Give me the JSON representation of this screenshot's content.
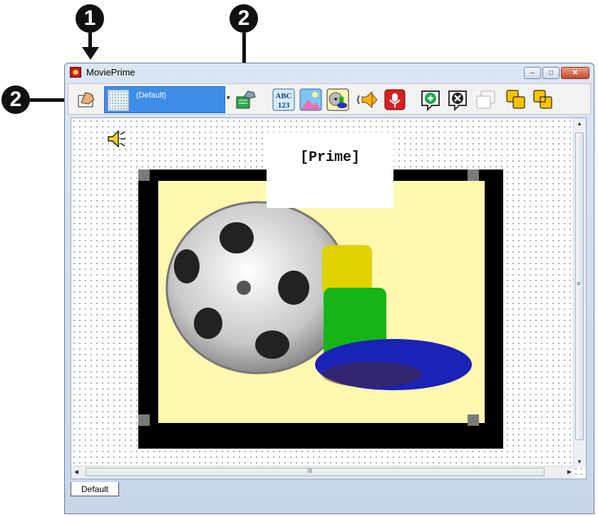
{
  "callouts": {
    "one": "1",
    "two_top": "2",
    "two_left": "2"
  },
  "window": {
    "title": "MoviePrime",
    "caption": {
      "minimize": "–",
      "maximize": "□",
      "close": "✕"
    }
  },
  "toolbar": {
    "layout_combo": {
      "value": "(Default)",
      "arrow": "▾"
    },
    "icons": [
      "edit-hand-icon",
      "layout-thumbnail-icon",
      "new-layout-icon",
      "text-abc123-icon",
      "image-icon",
      "movie-icon",
      "sound-speaker-icon",
      "record-mic-icon",
      "add-button-icon",
      "delete-button-icon",
      "duplicate-icon",
      "bring-forward-icon",
      "send-backward-icon"
    ]
  },
  "canvas": {
    "label": "[Prime]",
    "scroll": {
      "up": "▲",
      "down": "▼",
      "left": "◀",
      "right": "▶",
      "grip": "≡",
      "hgrip": "III"
    }
  },
  "tabs": [
    {
      "label": "Default"
    }
  ],
  "colors": {
    "accent": "#3d8ee8",
    "frame": "#000000",
    "frame_fill": "#fff8b0"
  }
}
